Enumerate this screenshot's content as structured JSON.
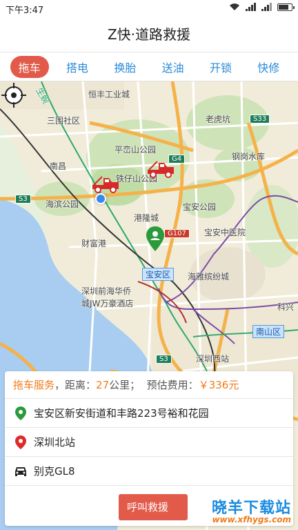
{
  "status": {
    "time": "下午3:47"
  },
  "app": {
    "title": "Z快·道路救援"
  },
  "tabs": [
    {
      "label": "拖车",
      "active": true
    },
    {
      "label": "搭电",
      "active": false
    },
    {
      "label": "换胎",
      "active": false
    },
    {
      "label": "送油",
      "active": false
    },
    {
      "label": "开锁",
      "active": false
    },
    {
      "label": "快修",
      "active": false
    }
  ],
  "map": {
    "labels": {
      "hengfeng": "恒丰工业城",
      "sanwei": "三围社区",
      "laohukeng": "老虎坑",
      "pingluan": "平峦山公园",
      "gangtou": "钢岗水库",
      "nanchang": "南昌",
      "tiezai": "铁仔山公园",
      "haibin": "海滨公园",
      "baoan_park": "宝安公园",
      "ganglong": "港隆城",
      "caifu": "财富港",
      "hospital": "宝安中医院",
      "haiya": "海雅缤纷城",
      "qianhai": "深圳前海华侨",
      "jw": "城JW万豪酒店",
      "keji": "科兴",
      "shenzhenxi": "深圳西站"
    },
    "roads": {
      "s3_a": "S3",
      "s33": "S33",
      "g4": "G4",
      "g107": "G107",
      "s3_b": "S3"
    },
    "districts": {
      "baoan": "宝安区",
      "nanshan": "南山区"
    },
    "metro_label": "生蜿"
  },
  "order": {
    "service": "拖车服务",
    "distance_label": "，距离：",
    "distance_value": "27",
    "distance_unit": "公里",
    "fee_label": "；  预估费用：",
    "fee_value": "￥336元",
    "origin": "宝安区新安街道和丰路223号裕和花园",
    "destination": "深圳北站",
    "vehicle": "别克GL8",
    "call_button": "呼叫救援"
  },
  "watermark": {
    "text": "晓羊下载站",
    "url": "www.xfhygs.com"
  },
  "colors": {
    "accent_red": "#e15a4a",
    "tab_blue": "#2a8ad8",
    "orange": "#f07a1a",
    "pin_green": "#2a9a3a"
  }
}
